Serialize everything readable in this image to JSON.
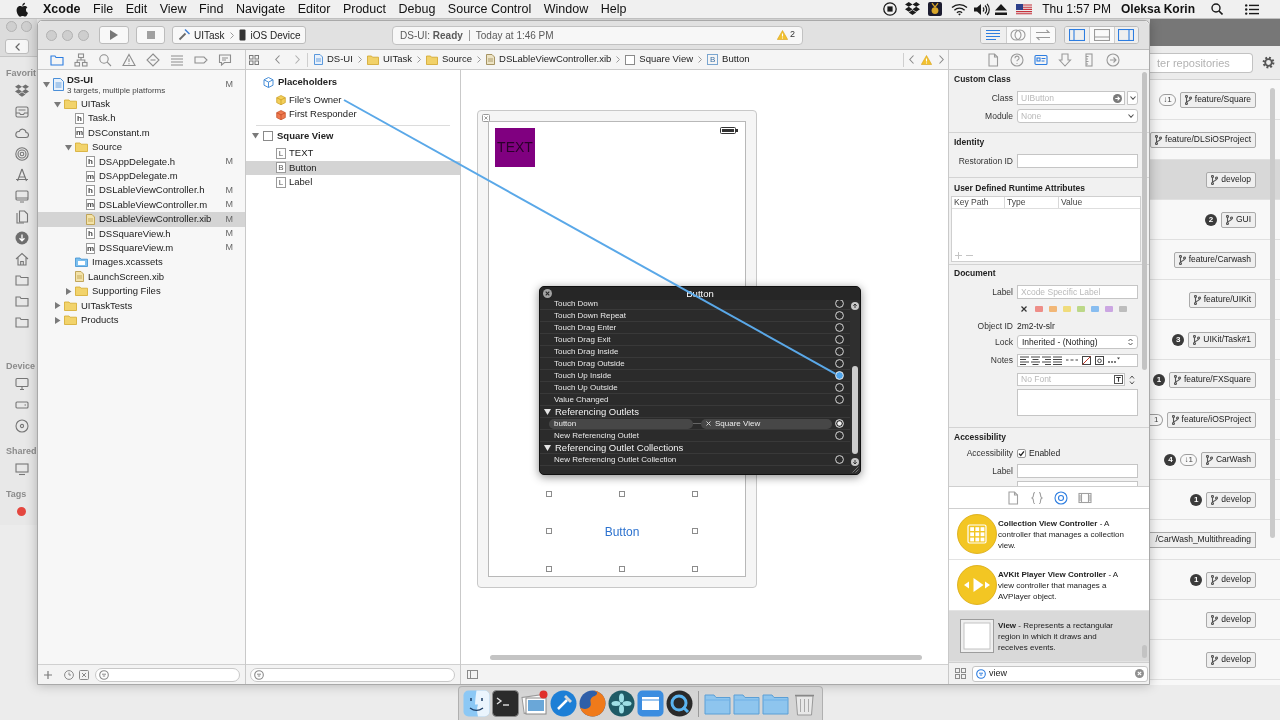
{
  "menu_bar": {
    "app": "Xcode",
    "menus": [
      "File",
      "Edit",
      "View",
      "Find",
      "Navigate",
      "Editor",
      "Product",
      "Debug",
      "Source Control",
      "Window",
      "Help"
    ],
    "clock": "Thu 1:57 PM",
    "user": "Oleksa Korin"
  },
  "finder_sidebar": [
    {
      "heading": "Favorit",
      "items": [
        {
          "kind": "box"
        },
        {
          "kind": "tray"
        },
        {
          "kind": "cloud"
        },
        {
          "kind": "rings"
        },
        {
          "kind": "apps"
        },
        {
          "kind": "desktop"
        },
        {
          "kind": "documents"
        },
        {
          "kind": "download"
        },
        {
          "kind": "home"
        },
        {
          "kind": "folder"
        },
        {
          "kind": "folder"
        },
        {
          "kind": "folder"
        }
      ]
    },
    {
      "heading": "Device",
      "items": [
        {
          "kind": "computer"
        },
        {
          "kind": "drive"
        },
        {
          "kind": "disc"
        }
      ]
    },
    {
      "heading": "Shared",
      "items": [
        {
          "kind": "display"
        }
      ]
    },
    {
      "heading": "Tags",
      "items": [
        {
          "kind": "tag",
          "color": "#e4473f"
        }
      ]
    }
  ],
  "xcode": {
    "toolbar": {
      "scheme": "UITask",
      "destination": "iOS Device",
      "status": "DS-UI: **Ready**",
      "status_time": "Today at 1:46 PM",
      "warning_count": "2",
      "editor_modes": [
        {
          "selected": true
        },
        {
          "selected": false
        },
        {
          "selected": false
        }
      ],
      "panels": [
        {
          "on": true
        },
        {
          "on": false
        },
        {
          "on": true
        }
      ]
    },
    "navigator_tabs": [
      {
        "selected": true
      },
      {
        "selected": false
      },
      {
        "selected": false
      },
      {
        "selected": false
      },
      {
        "selected": false
      },
      {
        "selected": false
      },
      {
        "selected": false
      },
      {
        "selected": false
      }
    ],
    "jump_bar": [
      {
        "kind": "project",
        "label": "DS-UI"
      },
      {
        "kind": "folder",
        "label": "UITask"
      },
      {
        "kind": "folder",
        "label": "Source"
      },
      {
        "kind": "xib",
        "label": "DSLableViewController.xib"
      },
      {
        "kind": "view",
        "label": "Square View"
      },
      {
        "kind": "lettered",
        "icon_text": "B",
        "label": "Button"
      }
    ],
    "inspector_tabs": [
      {
        "selected": false
      },
      {
        "selected": false
      },
      {
        "selected": true
      },
      {
        "selected": false
      },
      {
        "selected": false
      },
      {
        "selected": false
      }
    ],
    "project_tree": [
      {
        "kind": "project",
        "label": "DS-UI",
        "subtitle": "3 targets, multiple platforms",
        "badge": "M",
        "expanded": true,
        "selected": false,
        "children": [
          {
            "kind": "folder",
            "label": "UITask",
            "expanded": true,
            "selected": false,
            "children": [
              {
                "kind": "file",
                "icon_text": "h",
                "label": "Task.h",
                "selected": false
              },
              {
                "kind": "file",
                "icon_text": "m",
                "label": "DSConstant.m",
                "selected": false
              },
              {
                "kind": "folder",
                "label": "Source",
                "expanded": true,
                "selected": false,
                "children": [
                  {
                    "kind": "file",
                    "icon_text": "h",
                    "label": "DSAppDelegate.h",
                    "badge": "M",
                    "selected": false
                  },
                  {
                    "kind": "file",
                    "icon_text": "m",
                    "label": "DSAppDelegate.m",
                    "selected": false
                  },
                  {
                    "kind": "file",
                    "icon_text": "h",
                    "label": "DSLableViewController.h",
                    "badge": "M",
                    "selected": false
                  },
                  {
                    "kind": "file",
                    "icon_text": "m",
                    "label": "DSLableViewController.m",
                    "badge": "M",
                    "selected": false
                  },
                  {
                    "kind": "xib",
                    "label": "DSLableViewController.xib",
                    "badge": "M",
                    "selected": true
                  },
                  {
                    "kind": "file",
                    "icon_text": "h",
                    "label": "DSSquareView.h",
                    "badge": "M",
                    "selected": false
                  },
                  {
                    "kind": "file",
                    "icon_text": "m",
                    "label": "DSSquareView.m",
                    "badge": "M",
                    "selected": false
                  }
                ]
              },
              {
                "kind": "assets",
                "label": "Images.xcassets",
                "selected": false
              },
              {
                "kind": "xib",
                "label": "LaunchScreen.xib",
                "selected": false
              },
              {
                "kind": "folder",
                "label": "Supporting Files",
                "expanded": false,
                "selected": false
              }
            ]
          },
          {
            "kind": "folder",
            "label": "UITaskTests",
            "expanded": false,
            "selected": false
          },
          {
            "kind": "folder",
            "label": "Products",
            "expanded": false,
            "selected": false
          }
        ]
      }
    ],
    "outline": {
      "placeholders": {
        "title": "Placeholders",
        "items": [
          {
            "kind": "owner",
            "label": "File's Owner",
            "selected": false
          },
          {
            "kind": "responder",
            "label": "First Responder",
            "selected": false
          }
        ]
      },
      "tree": [
        {
          "label": "Square View",
          "expanded": true,
          "selected": false,
          "children": [
            {
              "icon_text": "L",
              "label": "TEXT",
              "selected": false
            },
            {
              "icon_text": "B",
              "label": "Button",
              "selected": true
            },
            {
              "icon_text": "L",
              "label": "Label",
              "selected": false
            }
          ]
        }
      ]
    },
    "canvas": {
      "label_text": "TEXT",
      "button_title": "Button"
    },
    "connections": {
      "title": "Button",
      "events": [
        {
          "label": "Touch Down",
          "connected": false,
          "highlighted": false
        },
        {
          "label": "Touch Down Repeat",
          "connected": false,
          "highlighted": false
        },
        {
          "label": "Touch Drag Enter",
          "connected": false,
          "highlighted": false
        },
        {
          "label": "Touch Drag Exit",
          "connected": false,
          "highlighted": false
        },
        {
          "label": "Touch Drag Inside",
          "connected": false,
          "highlighted": false
        },
        {
          "label": "Touch Drag Outside",
          "connected": false,
          "highlighted": false
        },
        {
          "label": "Touch Up Inside",
          "connected": false,
          "highlighted": true
        },
        {
          "label": "Touch Up Outside",
          "connected": false,
          "highlighted": false
        },
        {
          "label": "Value Changed",
          "connected": false,
          "highlighted": false
        }
      ],
      "sections": [
        {
          "title": "Referencing Outlets",
          "expanded": true,
          "rows": [
            {
              "kind": "outlet",
              "label": "button",
              "target": "Square View",
              "connected": true,
              "highlighted": false
            },
            {
              "kind": "new",
              "label": "New Referencing Outlet",
              "connected": false,
              "highlighted": false
            }
          ]
        },
        {
          "title": "Referencing Outlet Collections",
          "expanded": true,
          "rows": [
            {
              "kind": "new",
              "label": "New Referencing Outlet Collection",
              "connected": false,
              "highlighted": false
            }
          ]
        }
      ]
    },
    "inspector": {
      "custom_class": {
        "title": "Custom Class",
        "class": {
          "label": "Class",
          "placeholder": "UIButton"
        },
        "module": {
          "label": "Module",
          "placeholder": "None"
        }
      },
      "identity": {
        "title": "Identity",
        "restoration_id": {
          "label": "Restoration ID"
        }
      },
      "runtime_attributes": {
        "title": "User Defined Runtime Attributes",
        "columns": [
          "Key Path",
          "Type",
          "Value"
        ]
      },
      "document": {
        "title": "Document",
        "label": {
          "label": "Label",
          "placeholder": "Xcode Specific Label"
        },
        "label_colors": [
          {
            "color": "#ee8e88"
          },
          {
            "color": "#f2b777"
          },
          {
            "color": "#f0dc7c"
          },
          {
            "color": "#bcd888"
          },
          {
            "color": "#88bdf0"
          },
          {
            "color": "#cba6e2"
          },
          {
            "color": "#bdbdbd"
          }
        ],
        "object_id": {
          "label": "Object ID",
          "value": "2m2-tv-slr"
        },
        "lock": {
          "label": "Lock",
          "value": "Inherited - (Nothing)"
        },
        "notes": {
          "label": "Notes",
          "font_placeholder": "No Font"
        }
      },
      "accessibility": {
        "title": "Accessibility",
        "enabled": {
          "label": "Accessibility",
          "text": "Enabled",
          "checked": true
        },
        "label": {
          "label": "Label"
        }
      }
    },
    "library": {
      "tabs": [
        {
          "selected": false
        },
        {
          "selected": false
        },
        {
          "selected": true
        },
        {
          "selected": false
        }
      ],
      "items": [
        {
          "kind": "collection",
          "text": "**Collection View Controller** - A controller that manages a collection view.",
          "selected": false
        },
        {
          "kind": "player",
          "text": "**AVKit Player View Controller** - A view controller that manages a AVPlayer object.",
          "selected": false
        },
        {
          "kind": "view",
          "text": "**View** - Represents a rectangular region in which it draws and receives events.",
          "selected": true
        }
      ],
      "search": {
        "value": "view"
      }
    }
  },
  "github": {
    "search": {
      "placeholder": "ter repositories"
    },
    "rows": [
      {
        "behind": "↓1",
        "branch": "feature/Square",
        "clipped": false,
        "selected": false
      },
      {
        "branch": "feature/DLSiOSProject",
        "clipped": false,
        "selected": false
      },
      {
        "branch": "develop",
        "clipped": false,
        "selected": true
      },
      {
        "count": "2",
        "branch": "GUI",
        "clipped": false,
        "selected": false
      },
      {
        "branch": "feature/Carwash",
        "clipped": false,
        "selected": false
      },
      {
        "branch": "feature/UIKit",
        "clipped": false,
        "selected": false
      },
      {
        "count": "3",
        "branch": "UIKit/Task#1",
        "clipped": false,
        "selected": false
      },
      {
        "count": "1",
        "branch": "feature/FXSquare",
        "clipped": false,
        "selected": false
      },
      {
        "behind": "1",
        "branch": "feature/iOSProject",
        "clipped": true,
        "selected": false
      },
      {
        "count": "4",
        "behind": "↓1",
        "branch": "CarWash",
        "clipped": false,
        "selected": false
      },
      {
        "count": "1",
        "branch": "develop",
        "clipped": false,
        "selected": false
      },
      {
        "branch": "/CarWash_Multithreading",
        "clipped": true,
        "selected": false
      },
      {
        "count": "1",
        "branch": "develop",
        "clipped": false,
        "selected": false
      },
      {
        "branch": "develop",
        "clipped": false,
        "selected": false
      },
      {
        "branch": "develop",
        "clipped": false,
        "selected": false
      }
    ]
  },
  "dock": [
    {
      "kind": "face"
    },
    {
      "kind": "terminal"
    },
    {
      "kind": "photos"
    },
    {
      "kind": "hammer"
    },
    {
      "kind": "globe"
    },
    {
      "kind": "flower"
    },
    {
      "kind": "window"
    },
    {
      "kind": "ring"
    },
    {
      "kind": "folder"
    },
    {
      "kind": "folder"
    },
    {
      "kind": "folder"
    },
    {
      "kind": "trash"
    }
  ]
}
